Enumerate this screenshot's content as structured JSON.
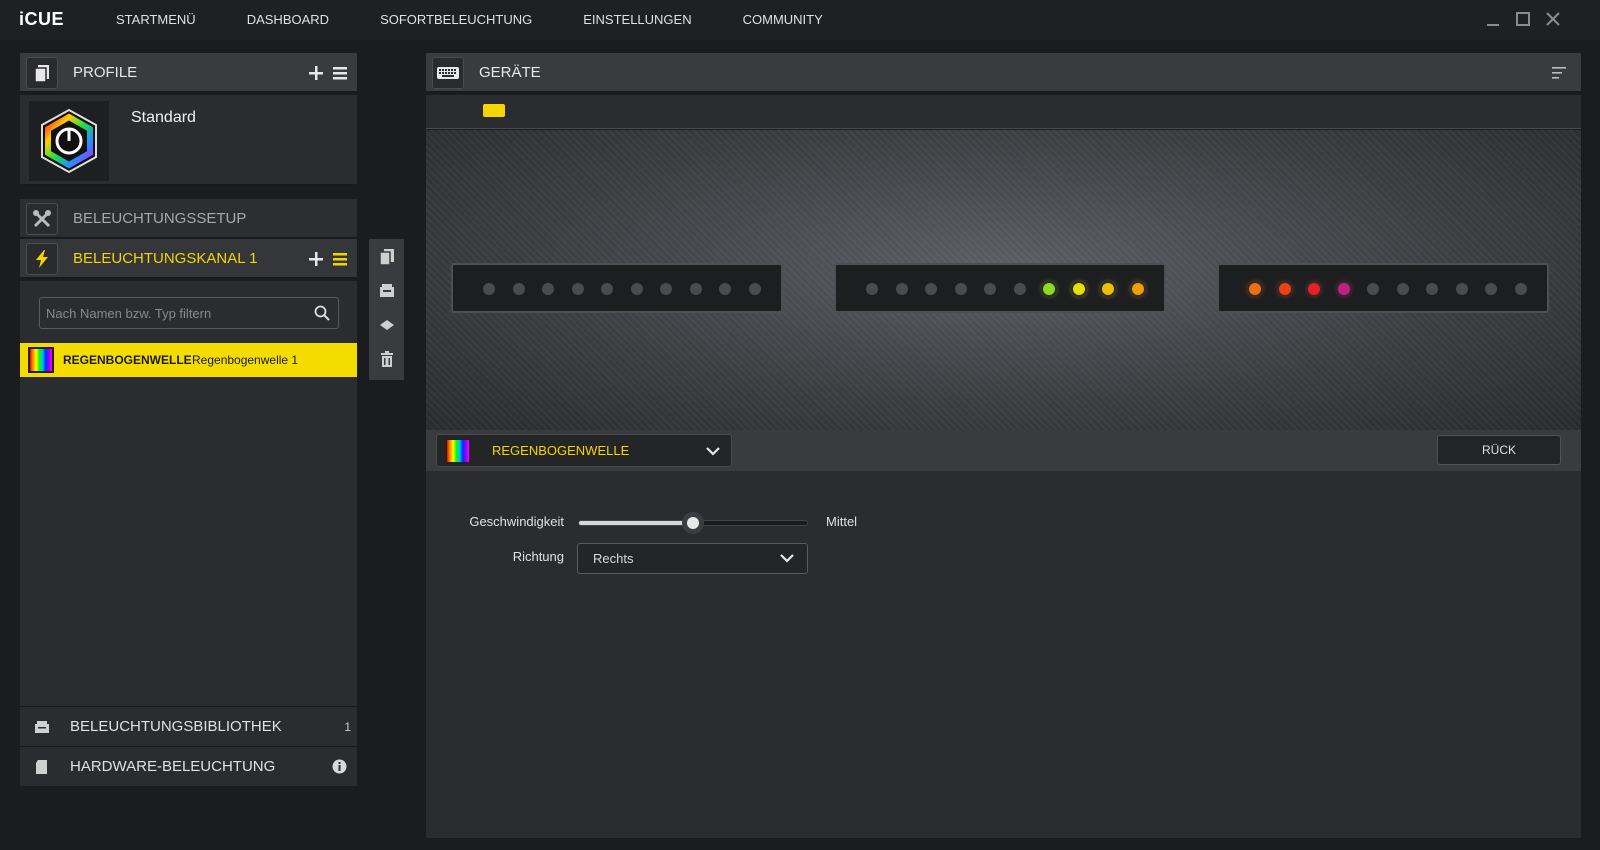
{
  "app": {
    "logo": "iCUE"
  },
  "nav": [
    "STARTMENÜ",
    "DASHBOARD",
    "SOFORTBELEUCHTUNG",
    "EINSTELLUNGEN",
    "COMMUNITY"
  ],
  "profiles": {
    "title": "PROFILE",
    "active_profile": "Standard"
  },
  "lighting_setup": {
    "title": "BELEUCHTUNGSSETUP"
  },
  "channel": {
    "title": "BELEUCHTUNGSKANAL 1",
    "filter_placeholder": "Nach Namen bzw. Typ filtern",
    "effects": [
      {
        "type": "REGENBOGENWELLE",
        "name": "Regenbogenwelle 1"
      }
    ]
  },
  "library": {
    "label": "BELEUCHTUNGSBIBLIOTHEK",
    "count": "1"
  },
  "hardware": {
    "label": "HARDWARE-BELEUCHTUNG"
  },
  "devices": {
    "title": "GERÄTE",
    "strips": [
      {
        "leds": [
          "off",
          "off",
          "off",
          "off",
          "off",
          "off",
          "off",
          "off",
          "off",
          "off"
        ]
      },
      {
        "leds": [
          "off",
          "off",
          "off",
          "off",
          "off",
          "off",
          "#8cdc1e",
          "#e8e000",
          "#f0c000",
          "#f0a000"
        ]
      },
      {
        "leds": [
          "#f07010",
          "#ee4010",
          "#e82020",
          "#c02080",
          "off",
          "off",
          "off",
          "off",
          "off",
          "off"
        ]
      }
    ]
  },
  "effect_editor": {
    "selected_effect": "REGENBOGENWELLE",
    "back_label": "RÜCK",
    "speed_label": "Geschwindigkeit",
    "speed_value": "Mittel",
    "speed_fraction": 0.5,
    "direction_label": "Richtung",
    "direction_value": "Rechts"
  },
  "colors": {
    "accent": "#f5d400",
    "led_off": "#4a4b4f"
  }
}
